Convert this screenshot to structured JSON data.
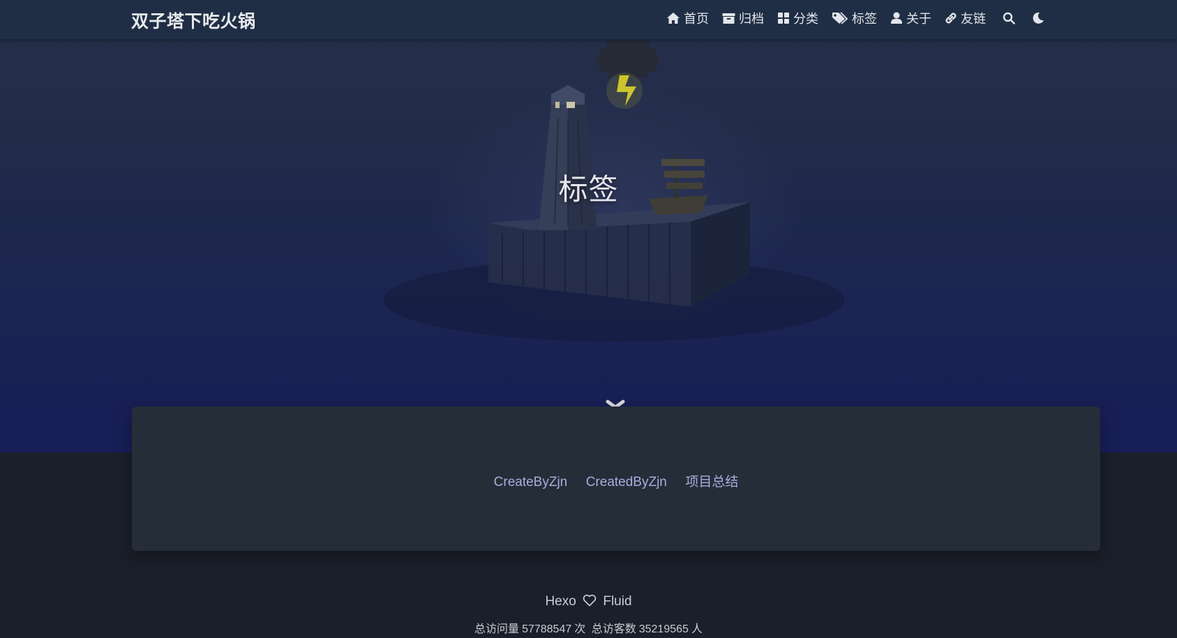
{
  "brand": {
    "title": "双子塔下吃火锅"
  },
  "nav": {
    "items": [
      {
        "label": "首页",
        "icon": "home-icon"
      },
      {
        "label": "归档",
        "icon": "archive-icon"
      },
      {
        "label": "分类",
        "icon": "category-icon"
      },
      {
        "label": "标签",
        "icon": "tag-icon"
      },
      {
        "label": "关于",
        "icon": "user-icon"
      },
      {
        "label": "友链",
        "icon": "link-icon"
      }
    ],
    "search_icon": "search-icon",
    "theme_icon": "moon-icon"
  },
  "banner": {
    "title": "标签"
  },
  "tags": [
    "CreateByZjn",
    "CreatedByZjn",
    "项目总结"
  ],
  "footer": {
    "left": "Hexo",
    "right": "Fluid",
    "stats": {
      "pv_label": "总访问量",
      "pv_value": "57788547",
      "pv_unit": "次",
      "uv_label": "总访客数",
      "uv_value": "35219565",
      "uv_unit": "人"
    }
  },
  "colors": {
    "navbar": "#1f2e45",
    "card": "#252d38",
    "page_bg": "#1b1f2b",
    "tag_link": "#a7aee0"
  }
}
